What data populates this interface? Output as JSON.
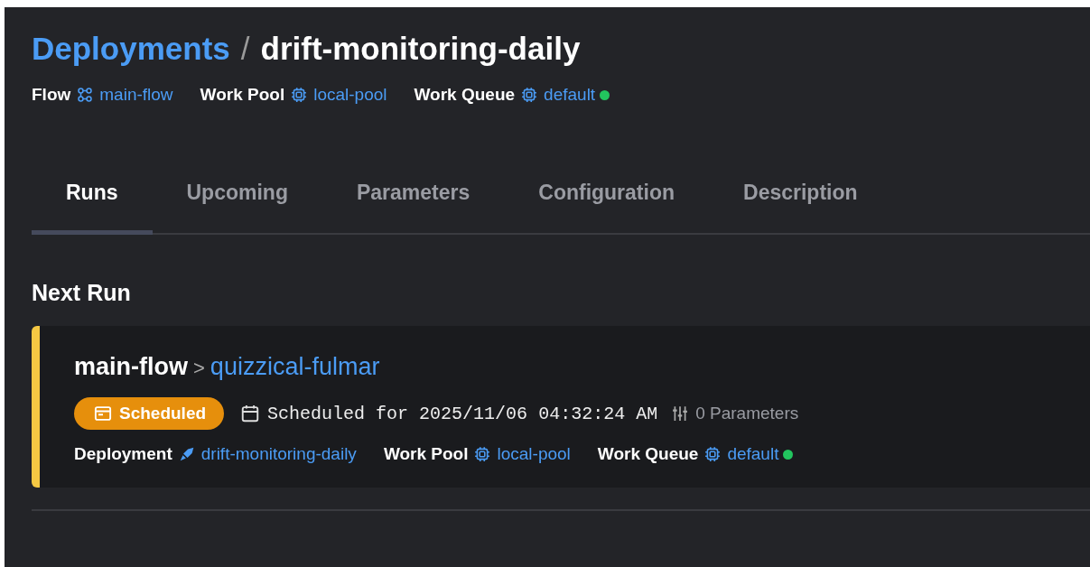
{
  "breadcrumb": {
    "parent": "Deployments",
    "separator": "/",
    "current": "drift-monitoring-daily"
  },
  "meta": [
    {
      "label": "Flow",
      "kind": "flow",
      "value": "main-flow"
    },
    {
      "label": "Work Pool",
      "kind": "pool",
      "value": "local-pool"
    },
    {
      "label": "Work Queue",
      "kind": "queue",
      "value": "default",
      "color": "#22c55e"
    }
  ],
  "tabs": [
    {
      "label": "Runs",
      "selected": true
    },
    {
      "label": "Upcoming",
      "selected": false
    },
    {
      "label": "Parameters",
      "selected": false
    },
    {
      "label": "Configuration",
      "selected": false
    },
    {
      "label": "Description",
      "selected": false
    }
  ],
  "next_run": {
    "heading": "Next Run",
    "flow": "main-flow",
    "separator": ">",
    "run_name": "quizzical-fulmar",
    "state": "Scheduled",
    "scheduled_text": "Scheduled for 2025/11/06 04:32:24 AM",
    "parameters": "0 Parameters",
    "meta": [
      {
        "label": "Deployment",
        "kind": "deployment",
        "value": "drift-monitoring-daily"
      },
      {
        "label": "Work Pool",
        "kind": "pool",
        "value": "local-pool"
      },
      {
        "label": "Work Queue",
        "kind": "queue",
        "value": "default",
        "color": "#22c55e"
      }
    ]
  }
}
